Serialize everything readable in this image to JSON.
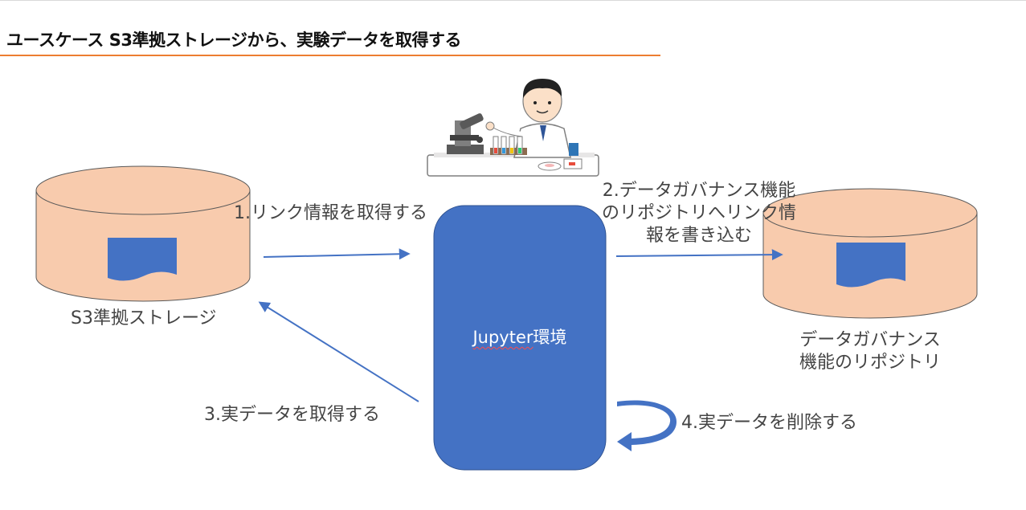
{
  "title": "ユースケース S3準拠ストレージから、実験データを取得する",
  "nodes": {
    "s3_storage": {
      "label": "S3準拠ストレージ",
      "fill": "#f8cbad"
    },
    "repository": {
      "label_line1": "データガバナンス",
      "label_line2": "機能のリポジトリ",
      "fill": "#f8cbad"
    },
    "jupyter": {
      "label_word": "Jupyter",
      "label_suffix": "環境",
      "fill": "#4472c4"
    },
    "scientist": {
      "icon": "scientist-microscope-icon"
    }
  },
  "steps": {
    "step1": "1.リンク情報を取得する",
    "step2_line1": "2.データガバナンス機能",
    "step2_line2": "のリポジトリへリンク情",
    "step2_line3": "報を書き込む",
    "step3": "3.実データを取得する",
    "step4": "4.実データを削除する"
  },
  "colors": {
    "accent": "#ed7d31",
    "arrow": "#4472c4",
    "document": "#4472c4",
    "cylinder_stroke": "#595959"
  }
}
